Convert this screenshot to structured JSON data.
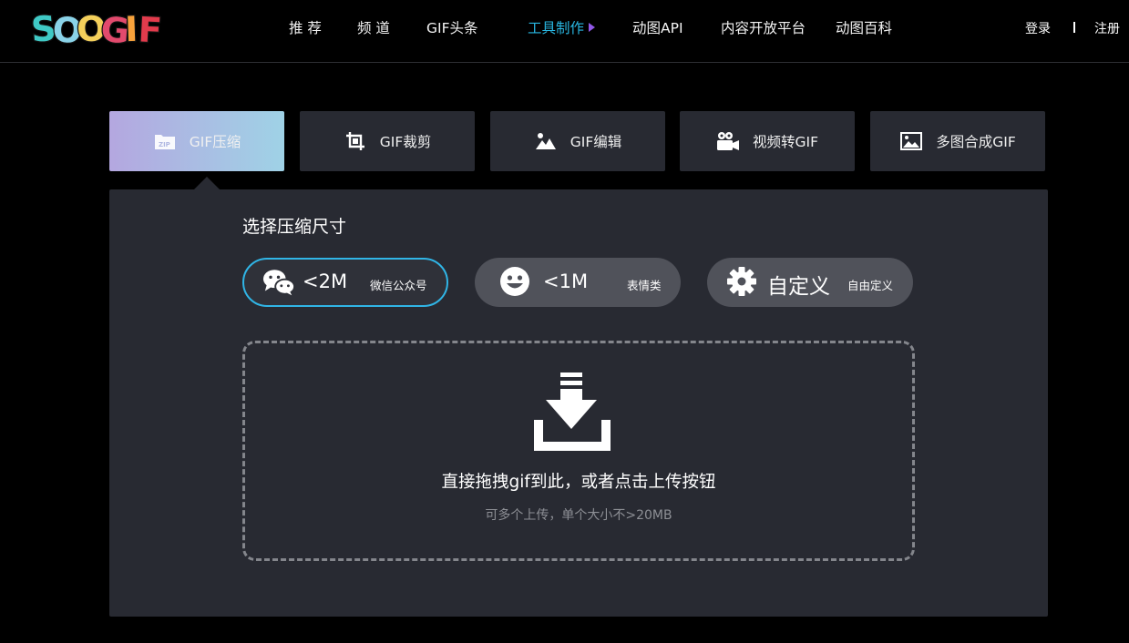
{
  "header": {
    "logo_text": "SOOGIF",
    "nav": [
      {
        "label": "推 荐"
      },
      {
        "label": "频 道"
      },
      {
        "label": "GIF头条"
      },
      {
        "label": "工具制作"
      },
      {
        "label": "动图API"
      },
      {
        "label": "内容开放平台"
      },
      {
        "label": "动图百科"
      }
    ],
    "login": "登录",
    "register": "注册"
  },
  "tools": [
    {
      "label": "GIF压缩",
      "icon": "zip-icon"
    },
    {
      "label": "GIF裁剪",
      "icon": "crop-icon"
    },
    {
      "label": "GIF编辑",
      "icon": "image-edit-icon"
    },
    {
      "label": "视频转GIF",
      "icon": "video-camera-icon"
    },
    {
      "label": "多图合成GIF",
      "icon": "picture-icon"
    }
  ],
  "panel": {
    "title": "选择压缩尺寸",
    "options": [
      {
        "main": "<2M",
        "sub": "微信公众号",
        "icon": "wechat-icon"
      },
      {
        "main": "<1M",
        "sub": "表情类",
        "icon": "smiley-icon"
      },
      {
        "main": "自定义",
        "sub": "自由定义",
        "icon": "gear-icon"
      }
    ],
    "dropzone": {
      "main": "直接拖拽gif到此，或者点击上传按钮",
      "sub": "可多个上传，单个大小不>20MB"
    }
  },
  "colors": {
    "accent": "#29b7e2",
    "caret": "#9158e8",
    "panel_bg": "#282a32",
    "pill_bg": "#50525a",
    "active_tab_gradient_start": "#b4a7e0",
    "active_tab_gradient_end": "#9fd2e6"
  }
}
